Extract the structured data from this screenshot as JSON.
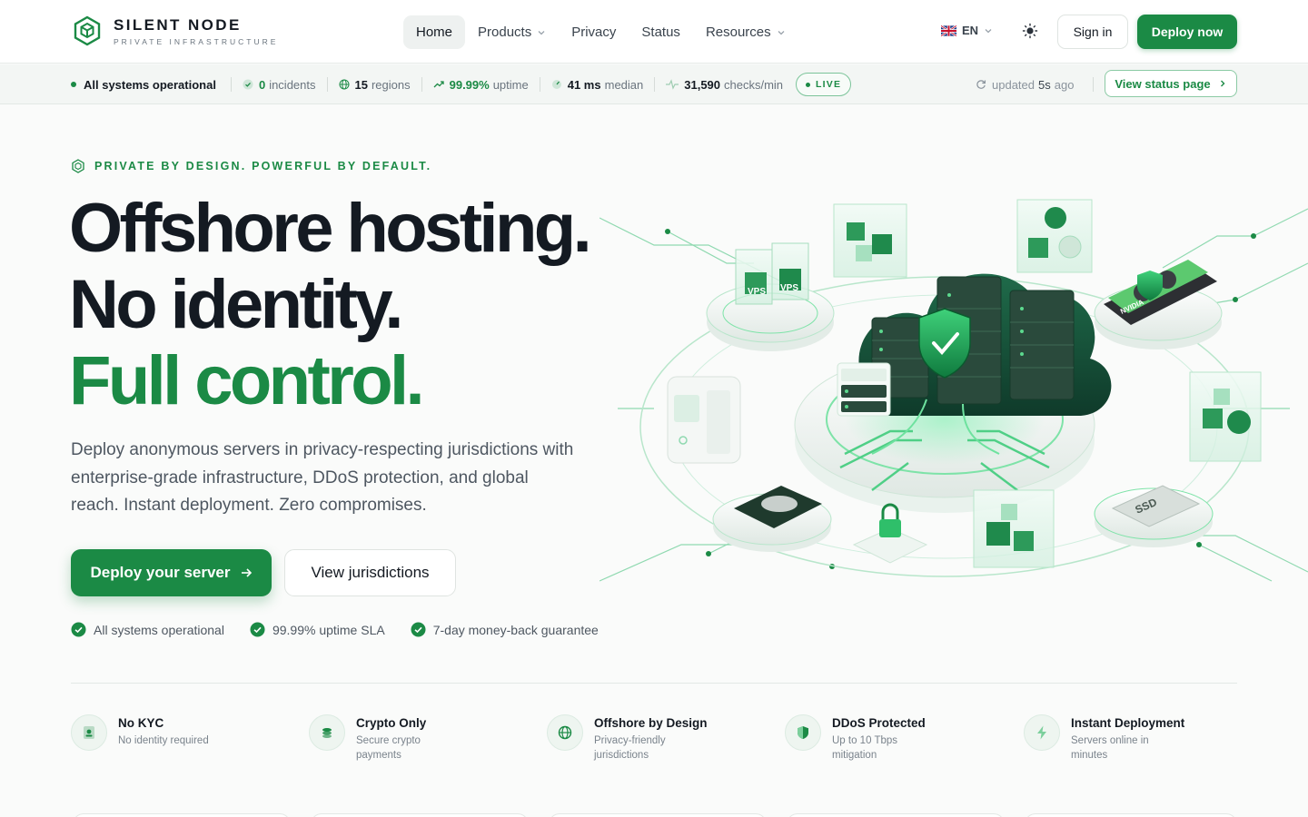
{
  "brand": {
    "name": "SILENT NODE",
    "tagline": "PRIVATE INFRASTRUCTURE",
    "accent": "#1b8a45"
  },
  "nav": {
    "items": [
      {
        "label": "Home",
        "active": true,
        "dropdown": false
      },
      {
        "label": "Products",
        "active": false,
        "dropdown": true
      },
      {
        "label": "Privacy",
        "active": false,
        "dropdown": false
      },
      {
        "label": "Status",
        "active": false,
        "dropdown": false
      },
      {
        "label": "Resources",
        "active": false,
        "dropdown": true
      }
    ],
    "language": "EN",
    "theme_icon": "sun-icon",
    "signin_label": "Sign in",
    "deploy_label": "Deploy now"
  },
  "status": {
    "systems": "All systems operational",
    "incidents_value": "0",
    "incidents_label": "incidents",
    "regions_value": "15",
    "regions_label": "regions",
    "uptime_value": "99.99%",
    "uptime_label": "uptime",
    "latency_value": "41 ms",
    "latency_label": "median",
    "checks_value": "31,590",
    "checks_label": "checks/min",
    "live": "LIVE",
    "updated_prefix": "updated",
    "updated_value": "5s",
    "updated_suffix": "ago",
    "view_status": "View status page"
  },
  "hero": {
    "eyebrow": "PRIVATE BY DESIGN. POWERFUL BY DEFAULT.",
    "line1": "Offshore hosting.",
    "line2": "No identity.",
    "line3": "Full control.",
    "lede": "Deploy anonymous servers in privacy-respecting jurisdictions with enterprise-grade infrastructure, DDoS protection, and global reach. Instant deployment. Zero compromises.",
    "cta_primary": "Deploy your server",
    "cta_secondary": "View jurisdictions",
    "checks": [
      "All systems operational",
      "99.99% uptime SLA",
      "7-day money-back guarantee"
    ],
    "illustration_labels": {
      "vps_a": "VPS",
      "vps_b": "VPS",
      "gpu": "NVIDIA",
      "ssd": "SSD"
    }
  },
  "features": [
    {
      "title": "No KYC",
      "desc": "No identity required",
      "icon": "id-card-icon"
    },
    {
      "title": "Crypto Only",
      "desc": "Secure crypto payments",
      "icon": "coins-icon"
    },
    {
      "title": "Offshore by Design",
      "desc": "Privacy-friendly jurisdictions",
      "icon": "globe-icon"
    },
    {
      "title": "DDoS Protected",
      "desc": "Up to 10 Tbps mitigation",
      "icon": "shield-icon"
    },
    {
      "title": "Instant Deployment",
      "desc": "Servers online in minutes",
      "icon": "lightning-icon"
    }
  ]
}
